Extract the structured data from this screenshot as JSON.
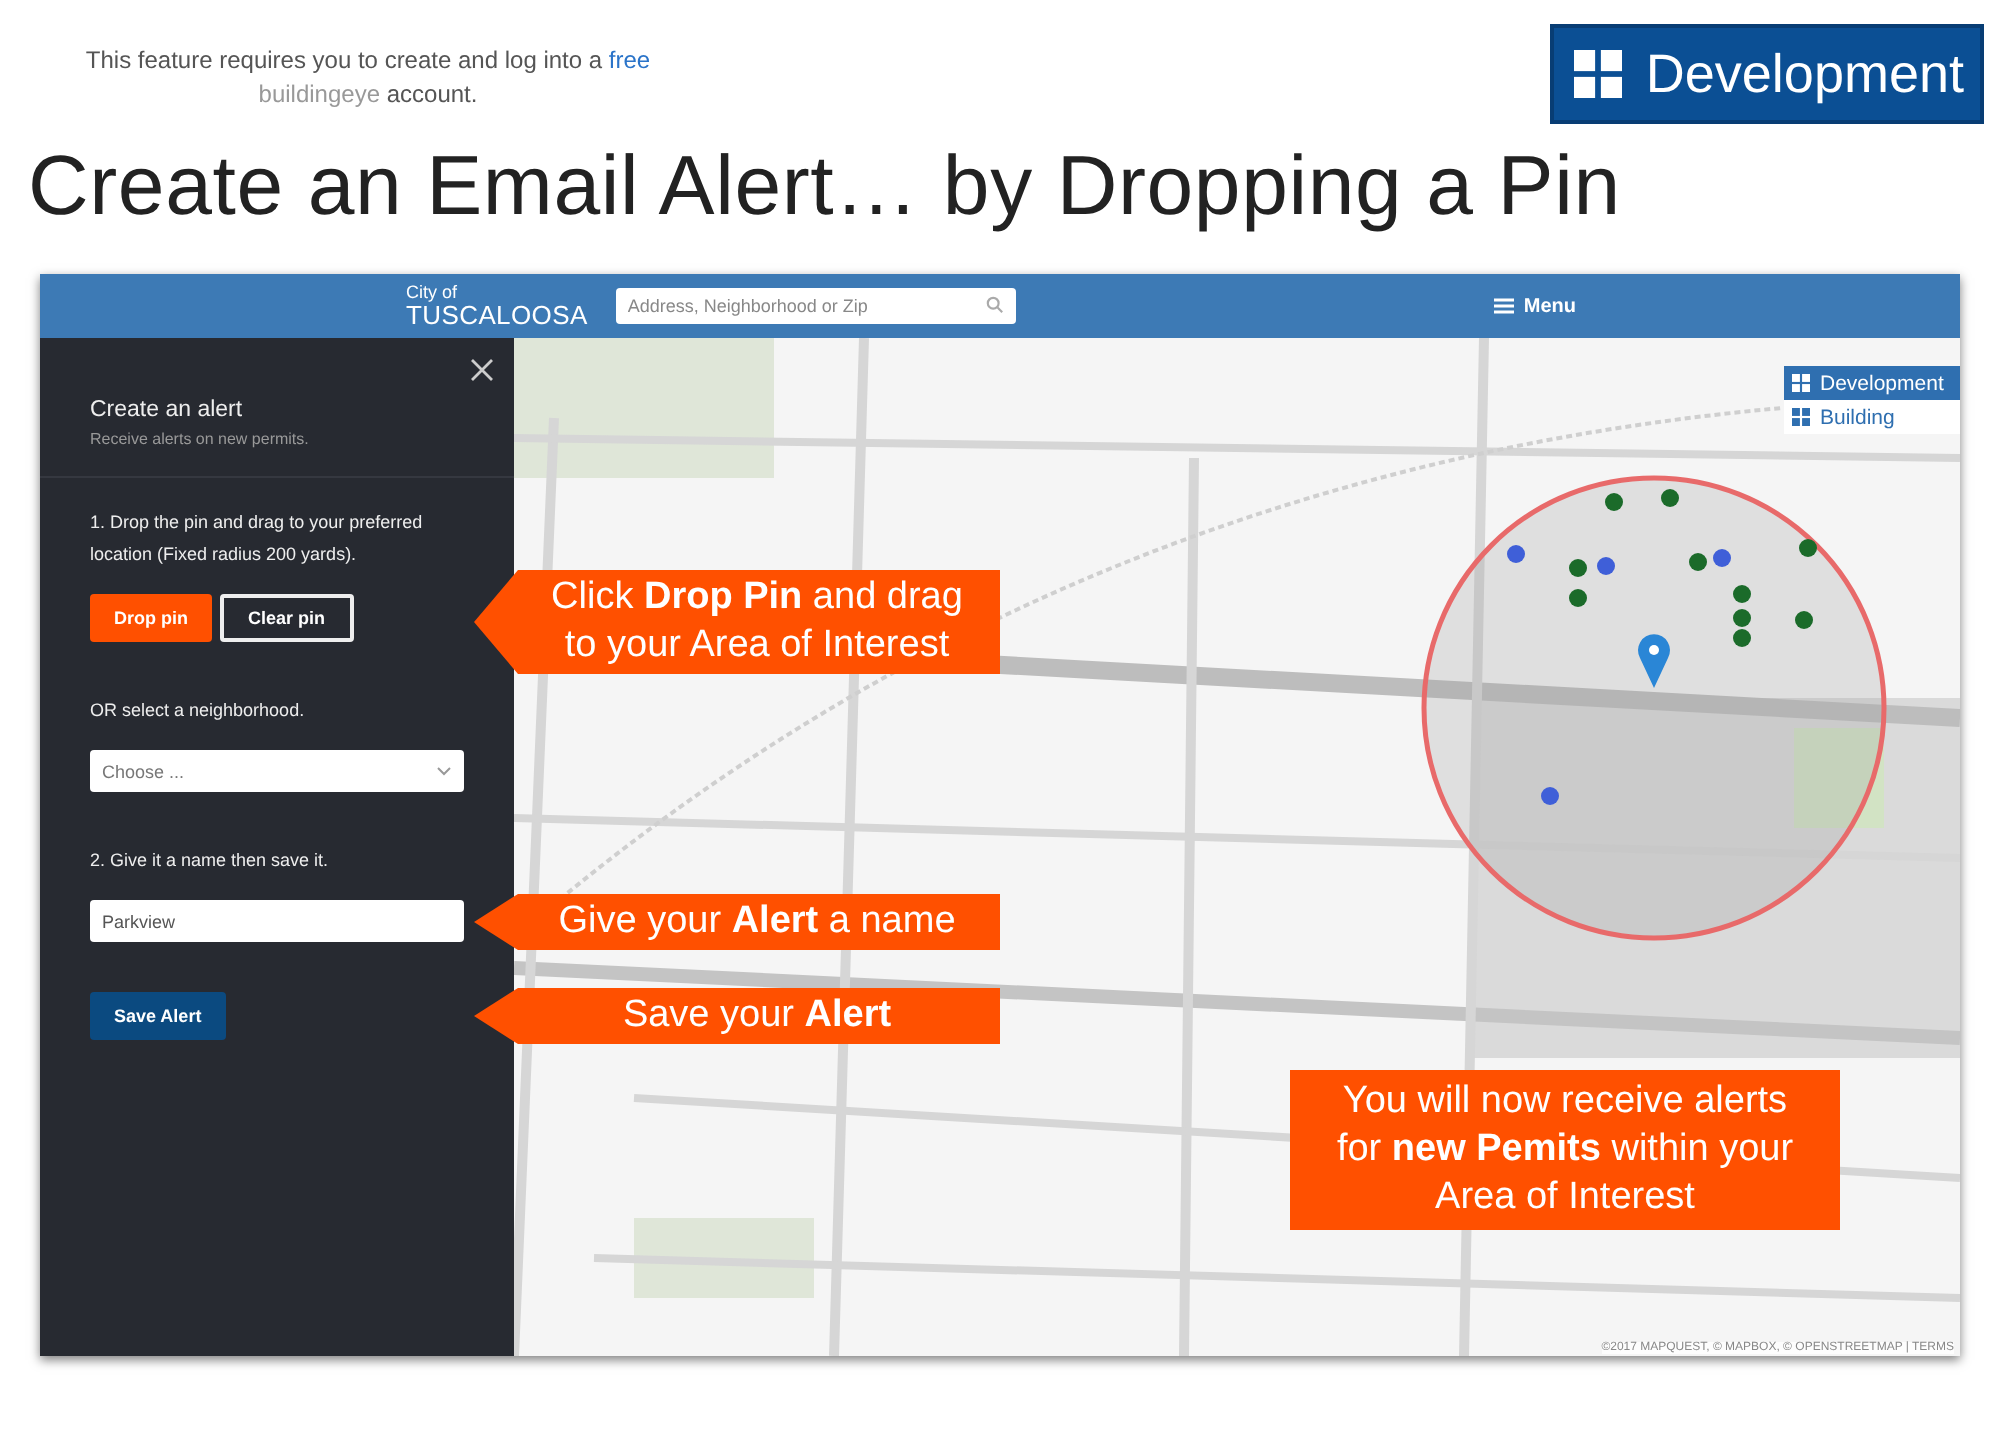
{
  "notice": {
    "before": "This feature requires you to create and log into a",
    "link": "free",
    "brand": "buildingeye",
    "after": "account."
  },
  "badge": {
    "label": "Development"
  },
  "title": "Create an Email Alert… by Dropping a Pin",
  "app": {
    "header": {
      "city_small": "City of",
      "city": "TUSCALOOSA",
      "search_placeholder": "Address, Neighborhood or Zip",
      "menu": "Menu"
    },
    "sidebar": {
      "title": "Create an alert",
      "subtitle": "Receive alerts on new permits.",
      "step1": "1. Drop the pin and drag to your preferred location (Fixed radius 200 yards).",
      "buttons": [
        {
          "label": "Drop pin",
          "kind": "primary"
        },
        {
          "label": "Clear pin",
          "kind": "outline"
        }
      ],
      "or_label": "OR select a neighborhood.",
      "select_placeholder": "Choose ...",
      "step2": "2. Give it a name then save it.",
      "name_value": "Parkview",
      "save": "Save Alert"
    },
    "legend": [
      {
        "label": "Development",
        "selected": true
      },
      {
        "label": "Building",
        "selected": false
      }
    ],
    "attribution": "©2017 MAPQUEST, © MAPBOX, © OPENSTREETMAP | TERMS"
  },
  "callouts": [
    {
      "lines": [
        "Click **Drop Pin** and drag",
        "to your Area of Interest"
      ],
      "kind": "arrow"
    },
    {
      "lines": [
        "Give your **Alert** a name"
      ],
      "kind": "arrow"
    },
    {
      "lines": [
        "Save your **Alert**"
      ],
      "kind": "arrow"
    },
    {
      "lines": [
        "You will now receive alerts",
        "for **new Pemits** within your",
        "Area of Interest"
      ],
      "kind": "box"
    }
  ]
}
